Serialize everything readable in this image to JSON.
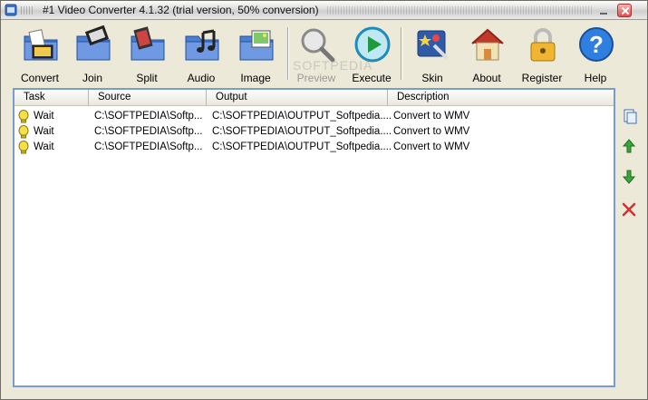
{
  "window": {
    "title": "#1 Video Converter 4.1.32 (trial version, 50% conversion)",
    "icon": "app-icon",
    "controls": [
      "minimize",
      "close"
    ]
  },
  "toolbar": {
    "buttons": [
      {
        "label": "Convert",
        "icon": "convert-folder-icon",
        "enabled": true
      },
      {
        "label": "Join",
        "icon": "join-folder-icon",
        "enabled": true
      },
      {
        "label": "Split",
        "icon": "split-folder-icon",
        "enabled": true
      },
      {
        "label": "Audio",
        "icon": "audio-folder-icon",
        "enabled": true
      },
      {
        "label": "Image",
        "icon": "image-folder-icon",
        "enabled": true
      },
      {
        "label": "Preview",
        "icon": "magnifier-icon",
        "enabled": false
      },
      {
        "label": "Execute",
        "icon": "play-icon",
        "enabled": true
      },
      {
        "label": "Skin",
        "icon": "skin-icon",
        "enabled": true
      },
      {
        "label": "About",
        "icon": "house-icon",
        "enabled": true
      },
      {
        "label": "Register",
        "icon": "padlock-icon",
        "enabled": true
      },
      {
        "label": "Help",
        "icon": "help-icon",
        "enabled": true
      }
    ]
  },
  "watermark": "SOFTPEDIA",
  "task_list": {
    "columns": [
      "Task",
      "Source",
      "Output",
      "Description"
    ],
    "rows": [
      {
        "task": "Wait",
        "source": "C:\\SOFTPEDIA\\Softp...",
        "output": "C:\\SOFTPEDIA\\OUTPUT_Softpedia....",
        "description": "Convert to WMV"
      },
      {
        "task": "Wait",
        "source": "C:\\SOFTPEDIA\\Softp...",
        "output": "C:\\SOFTPEDIA\\OUTPUT_Softpedia....",
        "description": "Convert to WMV"
      },
      {
        "task": "Wait",
        "source": "C:\\SOFTPEDIA\\Softp...",
        "output": "C:\\SOFTPEDIA\\OUTPUT_Softpedia....",
        "description": "Convert to WMV"
      }
    ]
  },
  "side_buttons": [
    {
      "icon": "copy-icon",
      "color": "#3a6fb8"
    },
    {
      "icon": "arrow-up-icon",
      "color": "#3aa63a"
    },
    {
      "icon": "arrow-down-icon",
      "color": "#3aa63a"
    },
    {
      "icon": "delete-icon",
      "color": "#d03030"
    }
  ],
  "colors": {
    "window_bg": "#ece9d8",
    "list_border": "#7a9bd0",
    "disabled_text": "#9a9a9a"
  }
}
